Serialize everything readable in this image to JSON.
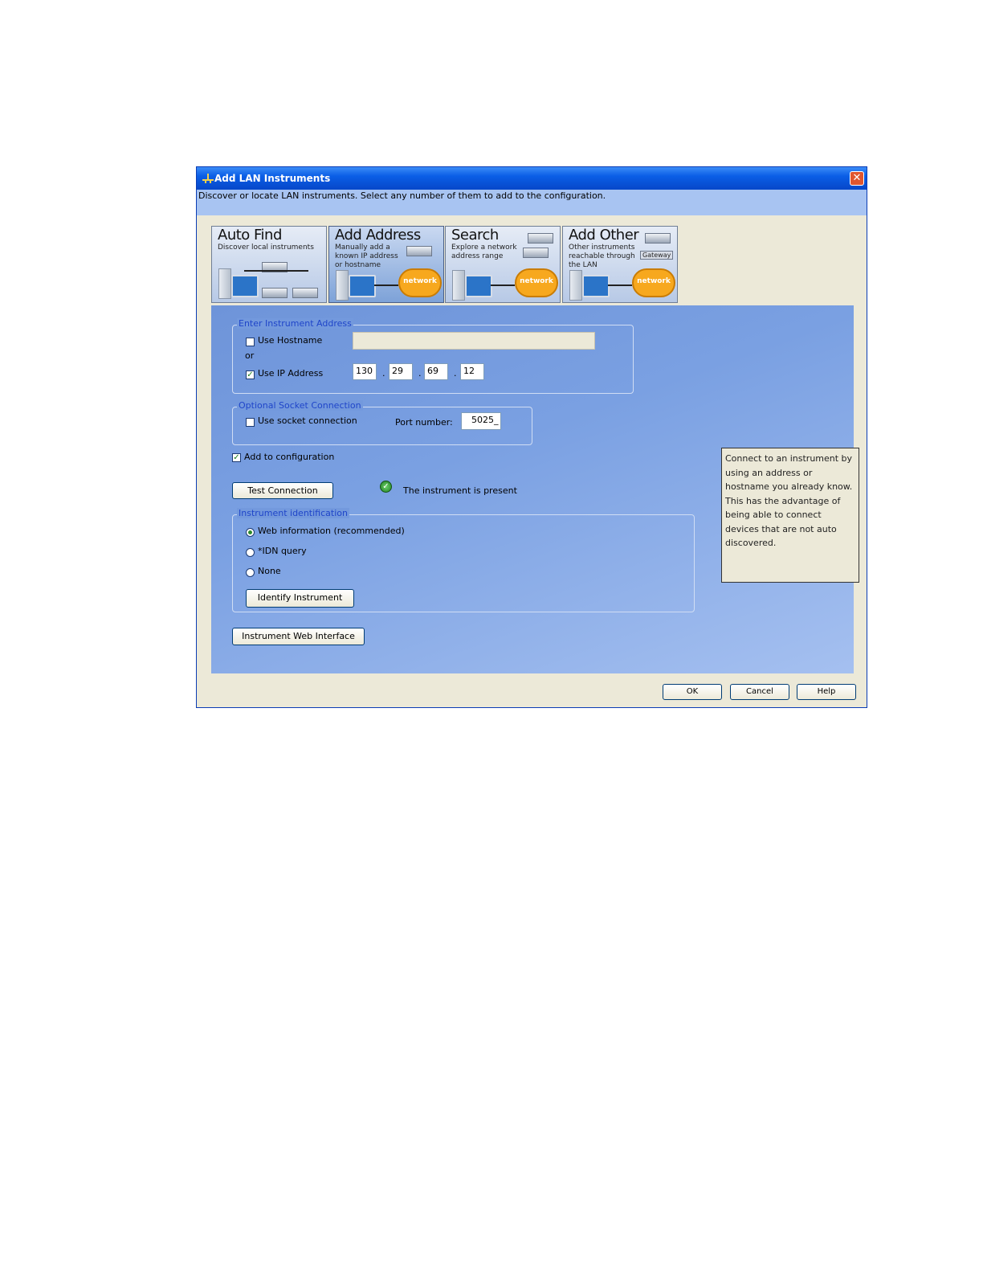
{
  "window": {
    "title": "Add LAN Instruments",
    "subtitle": "Discover or locate LAN instruments. Select any number of them to add to the configuration.",
    "close_glyph": "✕"
  },
  "tabs": [
    {
      "title": "Auto Find",
      "desc": "Discover local instruments",
      "active": false
    },
    {
      "title": "Add Address",
      "desc": "Manually add a known IP address or hostname",
      "cloud": "network",
      "active": true
    },
    {
      "title": "Search",
      "desc": "Explore a network address range",
      "cloud": "network",
      "active": false
    },
    {
      "title": "Add Other",
      "desc": "Other instruments reachable through the LAN",
      "gateway": "Gateway",
      "cloud": "network",
      "active": false
    }
  ],
  "address_group": {
    "legend": "Enter Instrument Address",
    "use_hostname_label": "Use Hostname",
    "use_hostname_checked": false,
    "hostname_value": "",
    "or_label": "or",
    "use_ip_label": "Use IP Address",
    "use_ip_checked": true,
    "ip": [
      "130",
      "29",
      "69",
      "12"
    ],
    "dot": "."
  },
  "socket_group": {
    "legend": "Optional Socket Connection",
    "use_socket_label": "Use socket connection",
    "use_socket_checked": false,
    "port_label": "Port number:",
    "port_value": "5025_"
  },
  "add_to_config": {
    "label": "Add to configuration",
    "checked": true
  },
  "test": {
    "button": "Test Connection",
    "status": "The instrument is present",
    "check_glyph": "✓"
  },
  "ident_group": {
    "legend": "Instrument identification",
    "options": [
      {
        "label": "Web information (recommended)",
        "selected": true
      },
      {
        "label": "*IDN query",
        "selected": false
      },
      {
        "label": "None",
        "selected": false
      }
    ],
    "identify_button": "Identify Instrument"
  },
  "web_interface_button": "Instrument Web Interface",
  "help_text": "Connect to an instrument by using an address or hostname you already know. This has the advantage of being able to connect devices that are not auto discovered.",
  "footer": {
    "ok": "OK",
    "cancel": "Cancel",
    "help": "Help"
  },
  "checked_glyph": "✓"
}
